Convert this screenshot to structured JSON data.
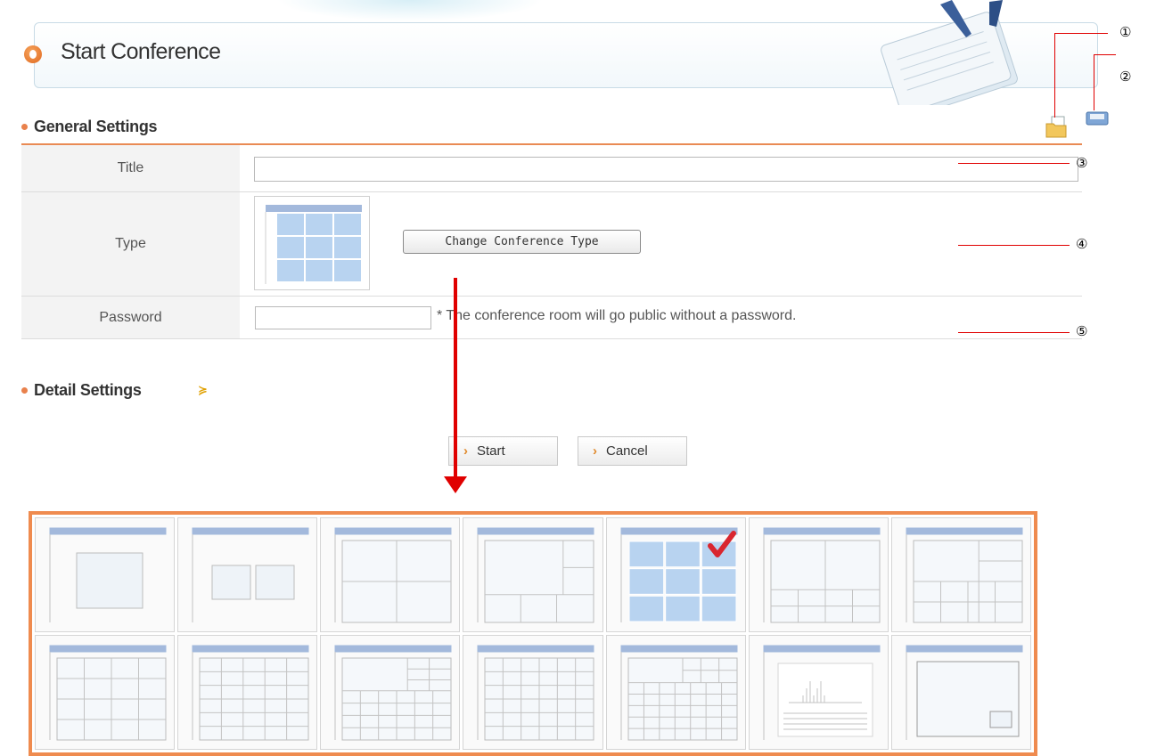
{
  "header": {
    "title": "Start Conference"
  },
  "general_settings": {
    "heading": "General Settings",
    "title_label": "Title",
    "title_value": "",
    "type_label": "Type",
    "change_type_label": "Change Conference Type",
    "password_label": "Password",
    "password_value": "",
    "password_note": "* The conference room will go public without a password."
  },
  "detail_settings": {
    "heading": "Detail Settings",
    "toggle_icon": "double-chevron-down-icon"
  },
  "actions": {
    "start_label": "Start",
    "cancel_label": "Cancel"
  },
  "toolbar_icons": [
    "folder-open-icon",
    "save-icon"
  ],
  "callouts": [
    "①",
    "②",
    "③",
    "④",
    "⑤"
  ],
  "conference_types": [
    {
      "layout": "single-large"
    },
    {
      "layout": "two-side-by-side"
    },
    {
      "layout": "four-quad"
    },
    {
      "layout": "one-large-plus-side"
    },
    {
      "layout": "nine-grid",
      "selected": true
    },
    {
      "layout": "two-top-four-bottom"
    },
    {
      "layout": "one-large-multi"
    },
    {
      "layout": "four-by-four"
    },
    {
      "layout": "five-by-five"
    },
    {
      "layout": "large-plus-many"
    },
    {
      "layout": "six-by-six"
    },
    {
      "layout": "many-plus-top"
    },
    {
      "layout": "document-view"
    },
    {
      "layout": "presentation-pip"
    }
  ],
  "colors": {
    "accent": "#ef8b4f",
    "annotation": "#e00000",
    "tile_blue": "#a9c8ec"
  }
}
